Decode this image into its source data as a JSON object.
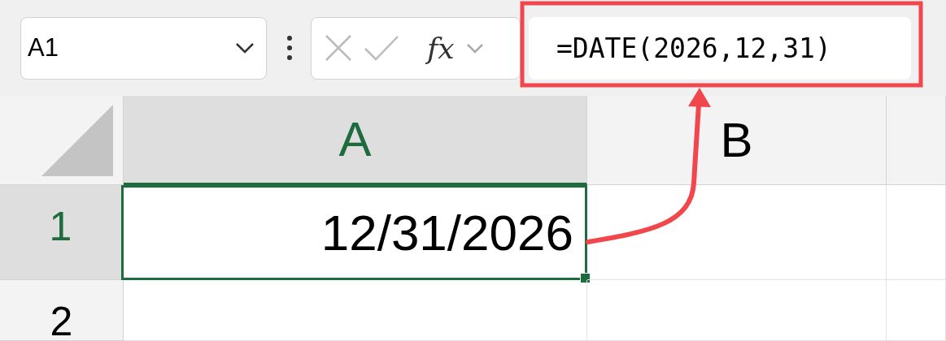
{
  "name_box": {
    "value": "A1"
  },
  "formula_bar": {
    "function_label": "fx",
    "formula": "=DATE(2026,12,31)"
  },
  "columns": [
    {
      "label": "A",
      "selected": true
    },
    {
      "label": "B",
      "selected": false
    },
    {
      "selected": false
    }
  ],
  "rows": [
    {
      "label": "1",
      "selected": true,
      "cells": [
        {
          "value": "12/31/2026",
          "active": true
        }
      ]
    },
    {
      "label": "2",
      "selected": false
    }
  ]
}
